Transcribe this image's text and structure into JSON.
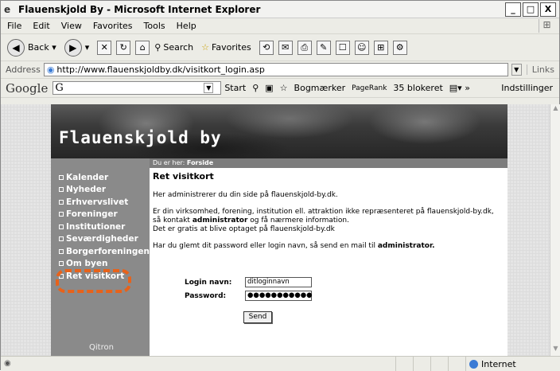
{
  "window": {
    "title": "Flauenskjold By - Microsoft Internet Explorer",
    "controls": [
      "_",
      "□",
      "X"
    ]
  },
  "menu": [
    "File",
    "Edit",
    "View",
    "Favorites",
    "Tools",
    "Help"
  ],
  "toolbar": {
    "back_label": "Back",
    "search_label": "Search",
    "favorites_label": "Favorites"
  },
  "address": {
    "label": "Address",
    "url": "http://www.flauenskjoldby.dk/visitkort_login.asp",
    "links_label": "Links"
  },
  "google_bar": {
    "brand": "Google",
    "query": "G",
    "start": "Start",
    "bookmarks": "Bogmærker",
    "pagerank": "PageRank",
    "blocked": "35 blokeret",
    "settings": "Indstillinger"
  },
  "site": {
    "brand_title": "Flauenskjold by",
    "breadcrumb_prefix": "Du er her:",
    "breadcrumb_current": "Forside",
    "nav": [
      "Kalender",
      "Nyheder",
      "Erhvervslivet",
      "Foreninger",
      "Institutioner",
      "Seværdigheder",
      "Borgerforeningen",
      "Om byen",
      "Ret visitkort"
    ],
    "footer_logo": "Qitron",
    "heading": "Ret visitkort",
    "intro": "Her administrerer du din side på flauenskjold-by.dk.",
    "para2_line1": "Er din virksomhed, forening, institution ell. attraktion ikke repræsenteret på flauenskjold-by.dk,",
    "para2_line2_pre": "så kontakt",
    "para2_line2_bold": "administrator",
    "para2_line2_post": "og få nærmere information.",
    "para2_line3": "Det er gratis at blive optaget på flauenskjold-by.dk",
    "forgot_pre": "Har du glemt dit password eller login navn, så send en mail til",
    "forgot_bold": "administrator.",
    "login_label": "Login navn:",
    "login_value": "ditloginnavn",
    "password_label": "Password:",
    "password_value": "●●●●●●●●●●●",
    "send_label": "Send"
  },
  "status": {
    "zone": "Internet"
  },
  "colors": {
    "highlight": "#e8621a",
    "sidebar": "#8a8a8a"
  }
}
